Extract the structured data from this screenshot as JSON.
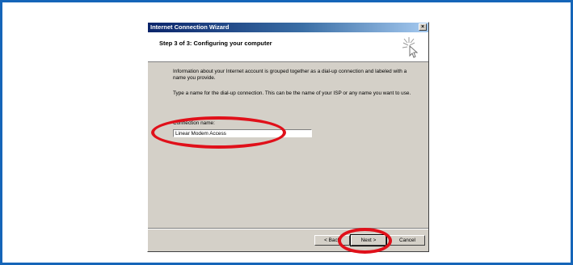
{
  "window": {
    "title": "Internet Connection Wizard",
    "close_glyph": "×"
  },
  "header": {
    "title": "Step 3 of 3: Configuring your computer",
    "icon": "wizard-sparkle-cursor-icon"
  },
  "body": {
    "paragraph1": "Information about your Internet account is grouped together as a dial-up connection and labeled with a name you provide.",
    "paragraph2": "Type a name for the dial-up connection. This can be the name of your ISP or any name you want to use.",
    "connection_label": "Connection name:",
    "connection_value": "Linear Modem Access"
  },
  "buttons": {
    "back": "< Back",
    "next": "Next >",
    "cancel": "Cancel"
  },
  "annotations": {
    "highlight_color": "#e0101a"
  },
  "colors": {
    "frame": "#1565b8",
    "dialog_bg": "#d4d0c8",
    "titlebar_start": "#0a246a"
  }
}
